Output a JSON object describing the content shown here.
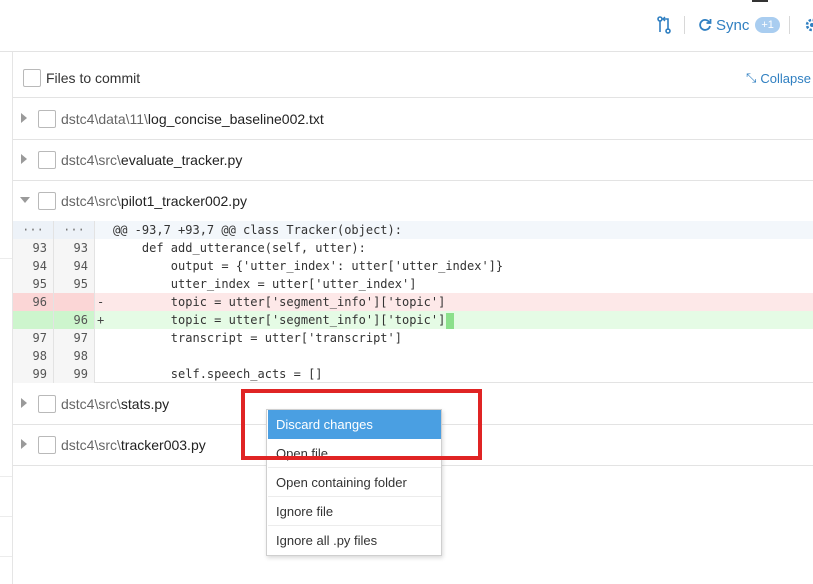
{
  "toolbar": {
    "sync_label": "Sync",
    "sync_badge": "+1"
  },
  "header": {
    "title": "Files to commit",
    "collapse_label": "Collapse a"
  },
  "files": [
    {
      "dir": "dstc4\\data\\11\\",
      "name": "log_concise_baseline002.txt",
      "expanded": false
    },
    {
      "dir": "dstc4\\src\\",
      "name": "evaluate_tracker.py",
      "expanded": false
    },
    {
      "dir": "dstc4\\src\\",
      "name": "pilot1_tracker002.py",
      "expanded": true
    },
    {
      "dir": "dstc4\\src\\",
      "name": "stats.py",
      "expanded": false
    },
    {
      "dir": "dstc4\\src\\",
      "name": "tracker003.py",
      "expanded": false
    }
  ],
  "diff": {
    "lines": [
      {
        "type": "hunk",
        "old": "···",
        "new": "···",
        "sign": "",
        "code": "@@ -93,7 +93,7 @@ class Tracker(object):"
      },
      {
        "type": "ctx",
        "old": "93",
        "new": "93",
        "sign": "",
        "code": "    def add_utterance(self, utter):"
      },
      {
        "type": "ctx",
        "old": "94",
        "new": "94",
        "sign": "",
        "code": "        output = {'utter_index': utter['utter_index']}"
      },
      {
        "type": "ctx",
        "old": "95",
        "new": "95",
        "sign": "",
        "code": "        utter_index = utter['utter_index']"
      },
      {
        "type": "del",
        "old": "96",
        "new": "",
        "sign": "-",
        "code": "        topic = utter['segment_info']['topic']"
      },
      {
        "type": "add",
        "old": "",
        "new": "96",
        "sign": "+",
        "code": "        topic = utter['segment_info']['topic']"
      },
      {
        "type": "ctx",
        "old": "97",
        "new": "97",
        "sign": "",
        "code": "        transcript = utter['transcript']"
      },
      {
        "type": "ctx",
        "old": "98",
        "new": "98",
        "sign": "",
        "code": ""
      },
      {
        "type": "ctx",
        "old": "99",
        "new": "99",
        "sign": "",
        "code": "        self.speech_acts = []"
      }
    ]
  },
  "context_menu": {
    "items": [
      {
        "label": "Discard changes",
        "selected": true
      },
      {
        "label": "Open file",
        "selected": false
      },
      {
        "label": "Open containing folder",
        "selected": false
      },
      {
        "label": "Ignore file",
        "selected": false
      },
      {
        "label": "Ignore all .py files",
        "selected": false
      }
    ]
  },
  "colors": {
    "accent": "#2f7fc1",
    "menu_highlight": "#4a9fe2",
    "annotation": "#e02424",
    "diff_add": "#e5fbe5",
    "diff_del": "#fde8e8"
  },
  "icons": {
    "pull_request": "pull-request-icon",
    "sync": "sync-icon",
    "settings": "gear-icon",
    "collapse": "collapse-icon"
  }
}
